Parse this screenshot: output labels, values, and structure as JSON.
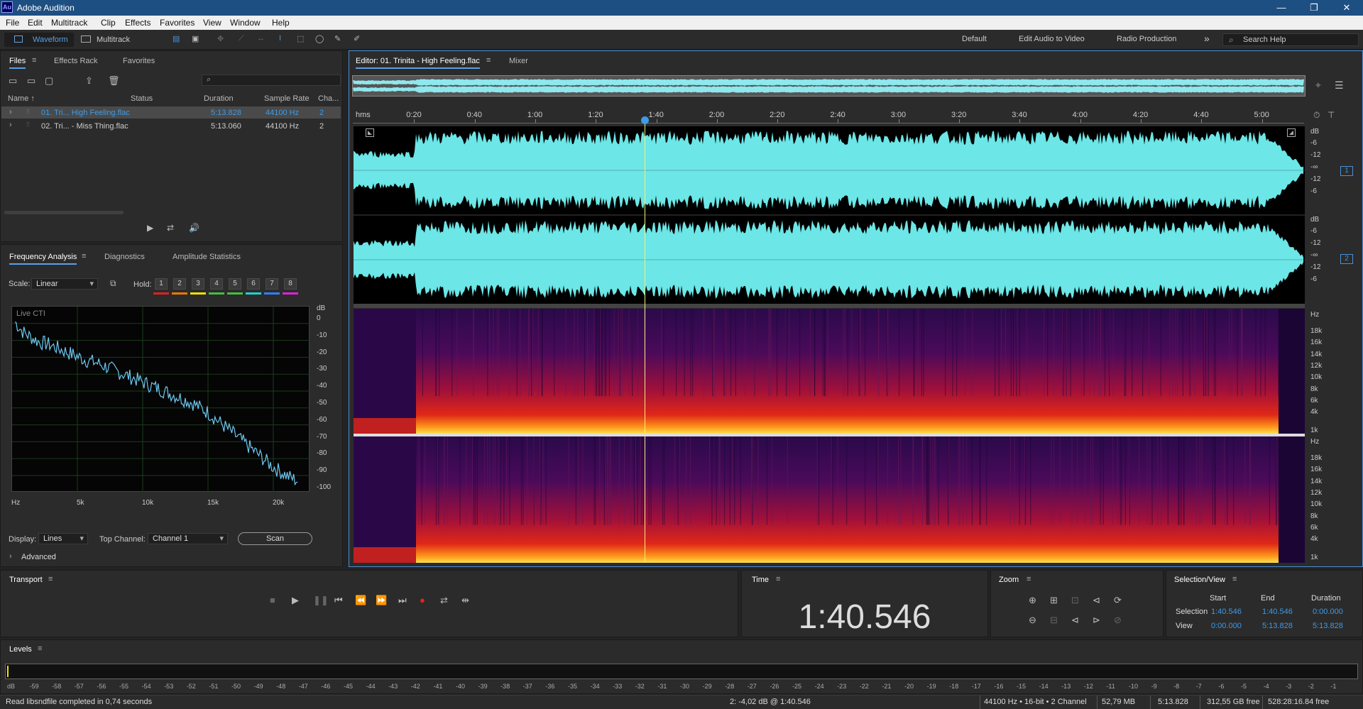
{
  "app": {
    "title": "Adobe Audition",
    "logo": "Au"
  },
  "window_controls": {
    "minimize": "—",
    "maximize": "❐",
    "close": "✕"
  },
  "menu": [
    "File",
    "Edit",
    "Multitrack",
    "Clip",
    "Effects",
    "Favorites",
    "View",
    "Window",
    "Help"
  ],
  "toolbar": {
    "waveform": "Waveform",
    "multitrack": "Multitrack"
  },
  "workspaces": [
    "Default",
    "Edit Audio to Video",
    "Radio Production"
  ],
  "workspace_more": "»",
  "search_help": "Search Help",
  "files_panel": {
    "tabs": [
      "Files",
      "Effects Rack",
      "Favorites"
    ],
    "columns": {
      "name": "Name ↑",
      "status": "Status",
      "duration": "Duration",
      "sample_rate": "Sample Rate",
      "channels": "Cha..."
    },
    "files": [
      {
        "name": "01. Tri... High Feeling.flac",
        "duration": "5:13.828",
        "sample_rate": "44100 Hz",
        "channels": "2"
      },
      {
        "name": "02. Tri... - Miss Thing.flac",
        "duration": "5:13.060",
        "sample_rate": "44100 Hz",
        "channels": "2"
      }
    ]
  },
  "analysis_panel": {
    "tabs": [
      "Frequency Analysis",
      "Diagnostics",
      "Amplitude Statistics"
    ],
    "scale_label": "Scale:",
    "scale_value": "Linear",
    "hold_label": "Hold:",
    "hold_buttons": [
      "1",
      "2",
      "3",
      "4",
      "5",
      "6",
      "7",
      "8"
    ],
    "hold_colors": [
      "#e02020",
      "#f07800",
      "#f0e000",
      "#40c040",
      "#40c040",
      "#20d0d0",
      "#3080ff",
      "#e020e0"
    ],
    "live_label": "Live CTI",
    "db_unit": "dB",
    "db_ticks": [
      "0",
      "-10",
      "-20",
      "-30",
      "-40",
      "-50",
      "-60",
      "-70",
      "-80",
      "-90",
      "-100"
    ],
    "x_ticks": [
      "Hz",
      "5k",
      "10k",
      "15k",
      "20k"
    ],
    "curve_db": [
      -4,
      -10,
      -13,
      -16,
      -17,
      -19,
      -21,
      -23,
      -25,
      -27,
      -28,
      -30,
      -32,
      -34,
      -36,
      -38,
      -40,
      -42,
      -44,
      -46,
      -48,
      -50,
      -52,
      -55,
      -58,
      -62,
      -66,
      -70,
      -74,
      -78,
      -82,
      -86,
      -90,
      -93,
      -96,
      -98
    ],
    "display_label": "Display:",
    "display_value": "Lines",
    "top_channel_label": "Top Channel:",
    "top_channel_value": "Channel 1",
    "scan_button": "Scan",
    "advanced": "Advanced"
  },
  "editor": {
    "tabs": [
      "Editor: 01. Trinita - High Feeling.flac",
      "Mixer"
    ],
    "ruler_unit": "hms",
    "ruler_ticks": [
      "0:20",
      "0:40",
      "1:00",
      "1:20",
      "1:40",
      "2:00",
      "2:20",
      "2:40",
      "3:00",
      "3:20",
      "3:40",
      "4:00",
      "4:20",
      "4:40",
      "5:00"
    ],
    "channel_db": {
      "unit": "dB",
      "ticks": [
        "-6",
        "-12",
        "-∞",
        "-12",
        "-6"
      ]
    },
    "channel_numbers": [
      "1",
      "2"
    ],
    "spectral_unit": "Hz",
    "spectral_ticks": [
      "18k",
      "16k",
      "14k",
      "12k",
      "10k",
      "8k",
      "6k",
      "4k",
      "1k"
    ],
    "playhead_fraction": 0.3197,
    "waveform_color": "#6ce6e6",
    "spectral_hot": "#ff9a1a"
  },
  "transport": {
    "title": "Transport"
  },
  "time": {
    "title": "Time",
    "value": "1:40.546"
  },
  "zoom": {
    "title": "Zoom"
  },
  "selection_view": {
    "title": "Selection/View",
    "headers": [
      "Start",
      "End",
      "Duration"
    ],
    "selection_label": "Selection",
    "selection": [
      "1:40.546",
      "1:40.546",
      "0:00.000"
    ],
    "view_label": "View",
    "view": [
      "0:00.000",
      "5:13.828",
      "5:13.828"
    ]
  },
  "levels": {
    "title": "Levels",
    "scale": [
      "dB",
      "-59",
      "-58",
      "-57",
      "-56",
      "-55",
      "-54",
      "-53",
      "-52",
      "-51",
      "-50",
      "-49",
      "-48",
      "-47",
      "-46",
      "-45",
      "-44",
      "-43",
      "-42",
      "-41",
      "-40",
      "-39",
      "-38",
      "-37",
      "-36",
      "-35",
      "-34",
      "-33",
      "-32",
      "-31",
      "-30",
      "-29",
      "-28",
      "-27",
      "-26",
      "-25",
      "-24",
      "-23",
      "-22",
      "-21",
      "-20",
      "-19",
      "-18",
      "-17",
      "-16",
      "-15",
      "-14",
      "-13",
      "-12",
      "-11",
      "-10",
      "-9",
      "-8",
      "-7",
      "-6",
      "-5",
      "-4",
      "-3",
      "-2",
      "-1",
      "0"
    ]
  },
  "status": {
    "message": "Read libsndfile completed in 0,74 seconds",
    "cursor": "2: -4,02 dB @ 1:40.546",
    "format": "44100 Hz • 16-bit • 2 Channel",
    "size": "52,79 MB",
    "duration": "5:13.828",
    "free": "312,55 GB free",
    "free_time": "528:28:16.84 free"
  }
}
